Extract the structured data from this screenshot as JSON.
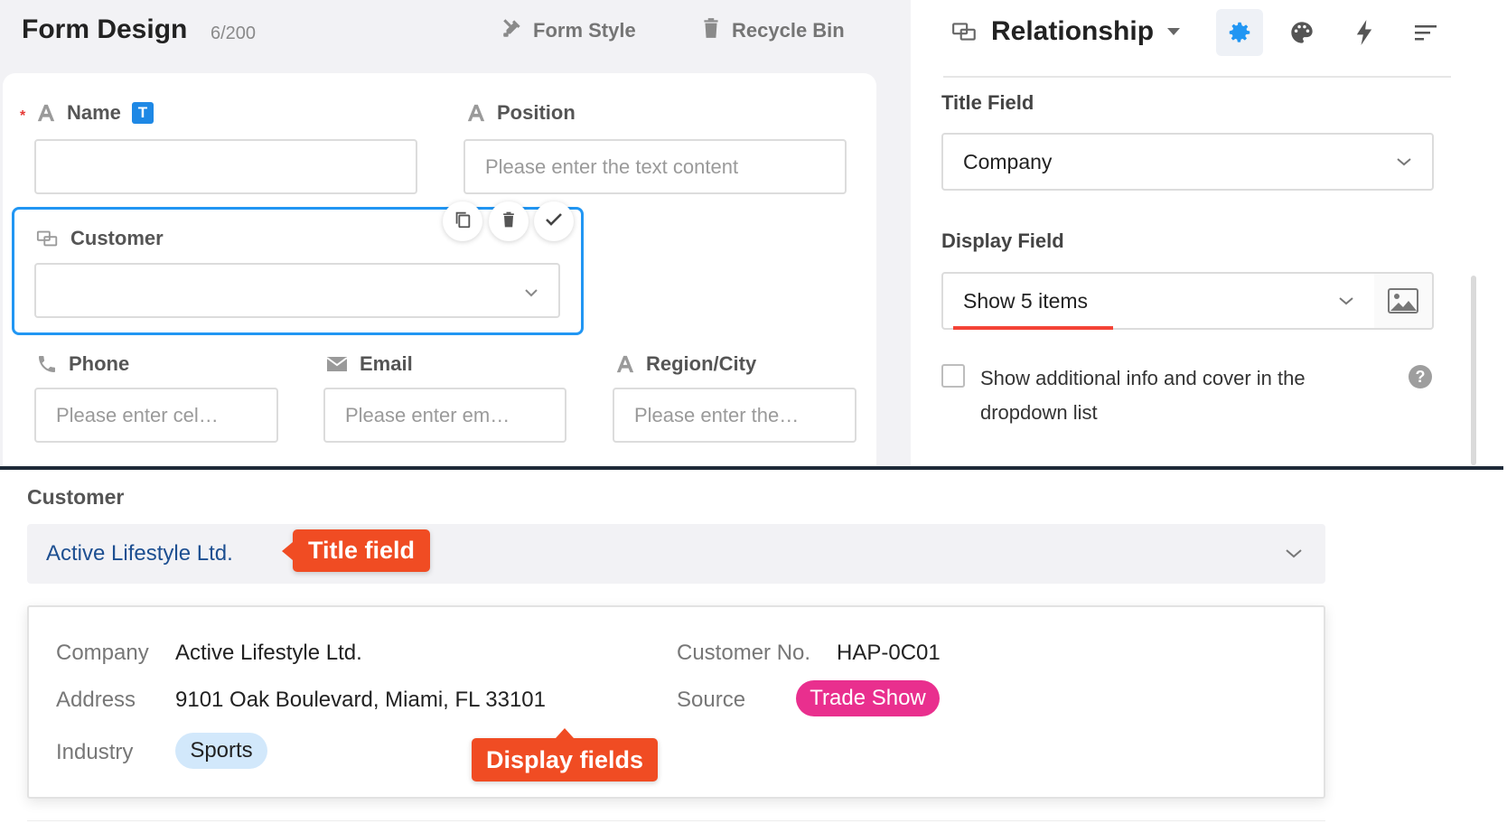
{
  "designer": {
    "title": "Form Design",
    "count": "6/200",
    "toolbar": {
      "form_style": "Form Style",
      "recycle_bin": "Recycle Bin"
    },
    "fields": {
      "name": {
        "label": "Name",
        "badge": "T",
        "value": ""
      },
      "position": {
        "label": "Position",
        "placeholder": "Please enter the text content"
      },
      "customer": {
        "label": "Customer",
        "value": ""
      },
      "phone": {
        "label": "Phone",
        "placeholder": "Please enter cel…"
      },
      "email": {
        "label": "Email",
        "placeholder": "Please enter em…"
      },
      "region": {
        "label": "Region/City",
        "placeholder": "Please enter the…"
      }
    },
    "field_actions": [
      "copy-icon",
      "trash-icon",
      "check-icon"
    ]
  },
  "settings": {
    "type_title": "Relationship",
    "tabs": [
      "gear-icon",
      "palette-icon",
      "lightning-icon",
      "sort-icon"
    ],
    "active_tab": "gear-icon",
    "title_field": {
      "label": "Title Field",
      "value": "Company"
    },
    "display_field": {
      "label": "Display Field",
      "value": "Show 5 items"
    },
    "checkbox": {
      "label": "Show additional info and cover in the dropdown list",
      "checked": false
    }
  },
  "preview": {
    "label": "Customer",
    "selected": "Active Lifestyle Ltd.",
    "title_callout": "Title field",
    "display_callout": "Display fields",
    "details": {
      "company_key": "Company",
      "company_val": "Active Lifestyle Ltd.",
      "address_key": "Address",
      "address_val": "9101 Oak Boulevard, Miami, FL 33101",
      "industry_key": "Industry",
      "industry_val": "Sports",
      "custno_key": "Customer No.",
      "custno_val": "HAP-0C01",
      "source_key": "Source",
      "source_val": "Trade Show"
    }
  },
  "colors": {
    "accent_blue": "#2196f3",
    "callout_orange": "#f04c23",
    "trade_show_pink": "#e92f8e",
    "sports_blue": "#d2e8fb"
  }
}
